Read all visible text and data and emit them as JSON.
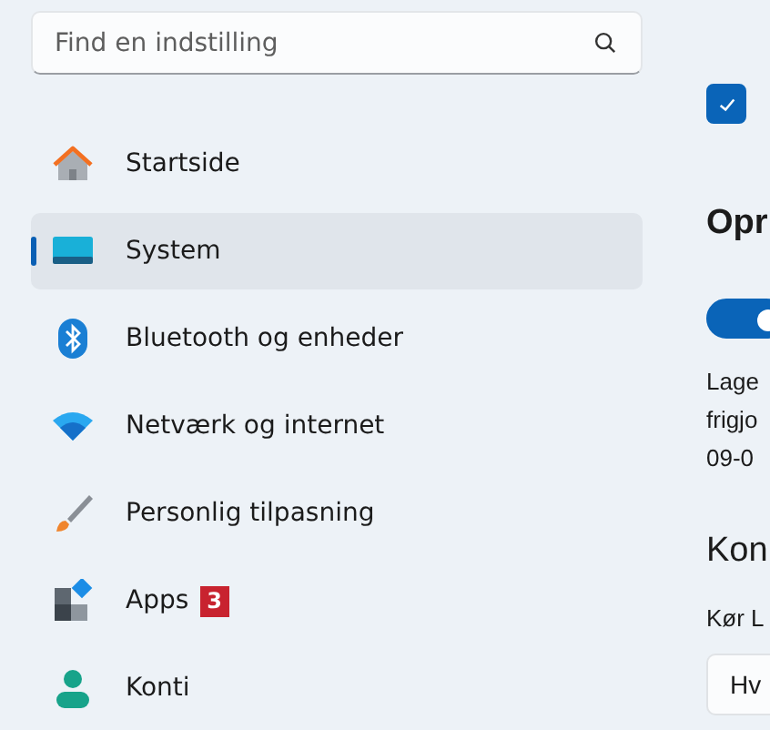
{
  "search": {
    "placeholder": "Find en indstilling"
  },
  "nav": [
    {
      "label": "Startside",
      "selected": false
    },
    {
      "label": "System",
      "selected": true
    },
    {
      "label": "Bluetooth og enheder",
      "selected": false
    },
    {
      "label": "Netværk og internet",
      "selected": false
    },
    {
      "label": "Personlig tilpasning",
      "selected": false
    },
    {
      "label": "Apps",
      "selected": false,
      "badge": "3"
    },
    {
      "label": "Konti",
      "selected": false
    }
  ],
  "content": {
    "checkbox": {
      "checked": true
    },
    "heading_1": "Opr",
    "toggle": {
      "on": true
    },
    "paragraph_lines": [
      "Lage",
      "frigjo",
      "09-0"
    ],
    "heading_2": "Kon",
    "field_label": "Kør L",
    "dropdown_value": "Hv"
  }
}
